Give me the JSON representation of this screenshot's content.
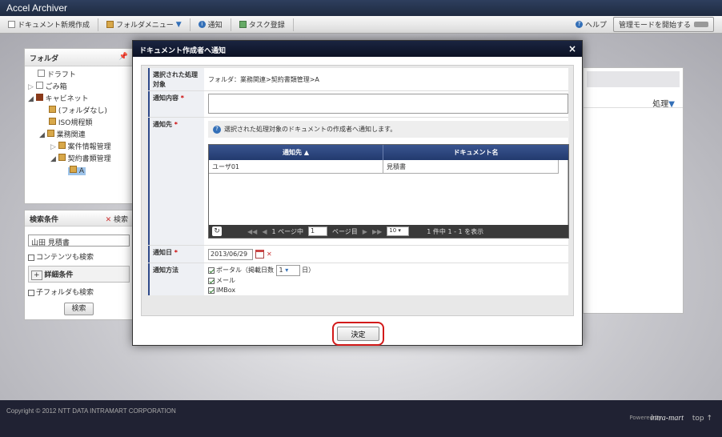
{
  "app": {
    "title": "Accel Archiver"
  },
  "toolbar": {
    "new_doc": "ドキュメント新規作成",
    "folder_menu": "フォルダメニュー",
    "notify": "通知",
    "task_register": "タスク登録",
    "help": "ヘルプ",
    "admin_mode": "管理モードを開始する"
  },
  "folder_panel": {
    "title": "フォルダ",
    "tree": {
      "draft": "ドラフト",
      "trash": "ごみ箱",
      "cabinet": "キャビネット",
      "no_folder": "(フォルダなし)",
      "iso": "ISO規程類",
      "business": "業務関連",
      "project_mgmt": "案件情報管理",
      "contract_mgmt": "契約書類管理",
      "a": "A"
    }
  },
  "search_panel": {
    "title": "検索条件",
    "search_link": "検索",
    "keyword": "山田 見積書",
    "content_search": "コンテンツも検索",
    "detail": "詳細条件",
    "subfolder": "子フォルダも検索",
    "button": "検索"
  },
  "right_panel": {
    "action": "処理"
  },
  "dialog": {
    "title": "ドキュメント作成者へ通知",
    "target_label": "選択された処理対象",
    "target_value": "フォルダ：業務関連>契約書類管理>A",
    "content_label": "通知内容",
    "to_label": "通知先",
    "required": "*",
    "hint": "選択された処理対象のドキュメントの作成者へ通知します。",
    "grid": {
      "col_recipient": "通知先",
      "col_document": "ドキュメント名",
      "rows": [
        {
          "recipient": "ユーザ01",
          "document": "見積書"
        }
      ]
    },
    "pager": {
      "page_prefix": "1 ページ中",
      "page": "1",
      "page_suffix": "ページ目",
      "per_page": "10",
      "summary": "1 件中 1 - 1 を表示"
    },
    "date_label": "通知日",
    "date_value": "2013/06/29",
    "method_label": "通知方法",
    "portal": "ポータル（掲載日数",
    "portal_days": "1",
    "portal_suffix": "日）",
    "mail": "メール",
    "imbox": "IMBox",
    "submit": "決定"
  },
  "footer": {
    "copyright": "Copyright © 2012 NTT DATA INTRAMART CORPORATION",
    "powered": "Powered by",
    "logo": "intra-mart",
    "top": "top ↑"
  },
  "colors": {
    "dialog_header": "#0c1224",
    "grid_header": "#2e4a8a",
    "highlight": "#d21a1a"
  }
}
